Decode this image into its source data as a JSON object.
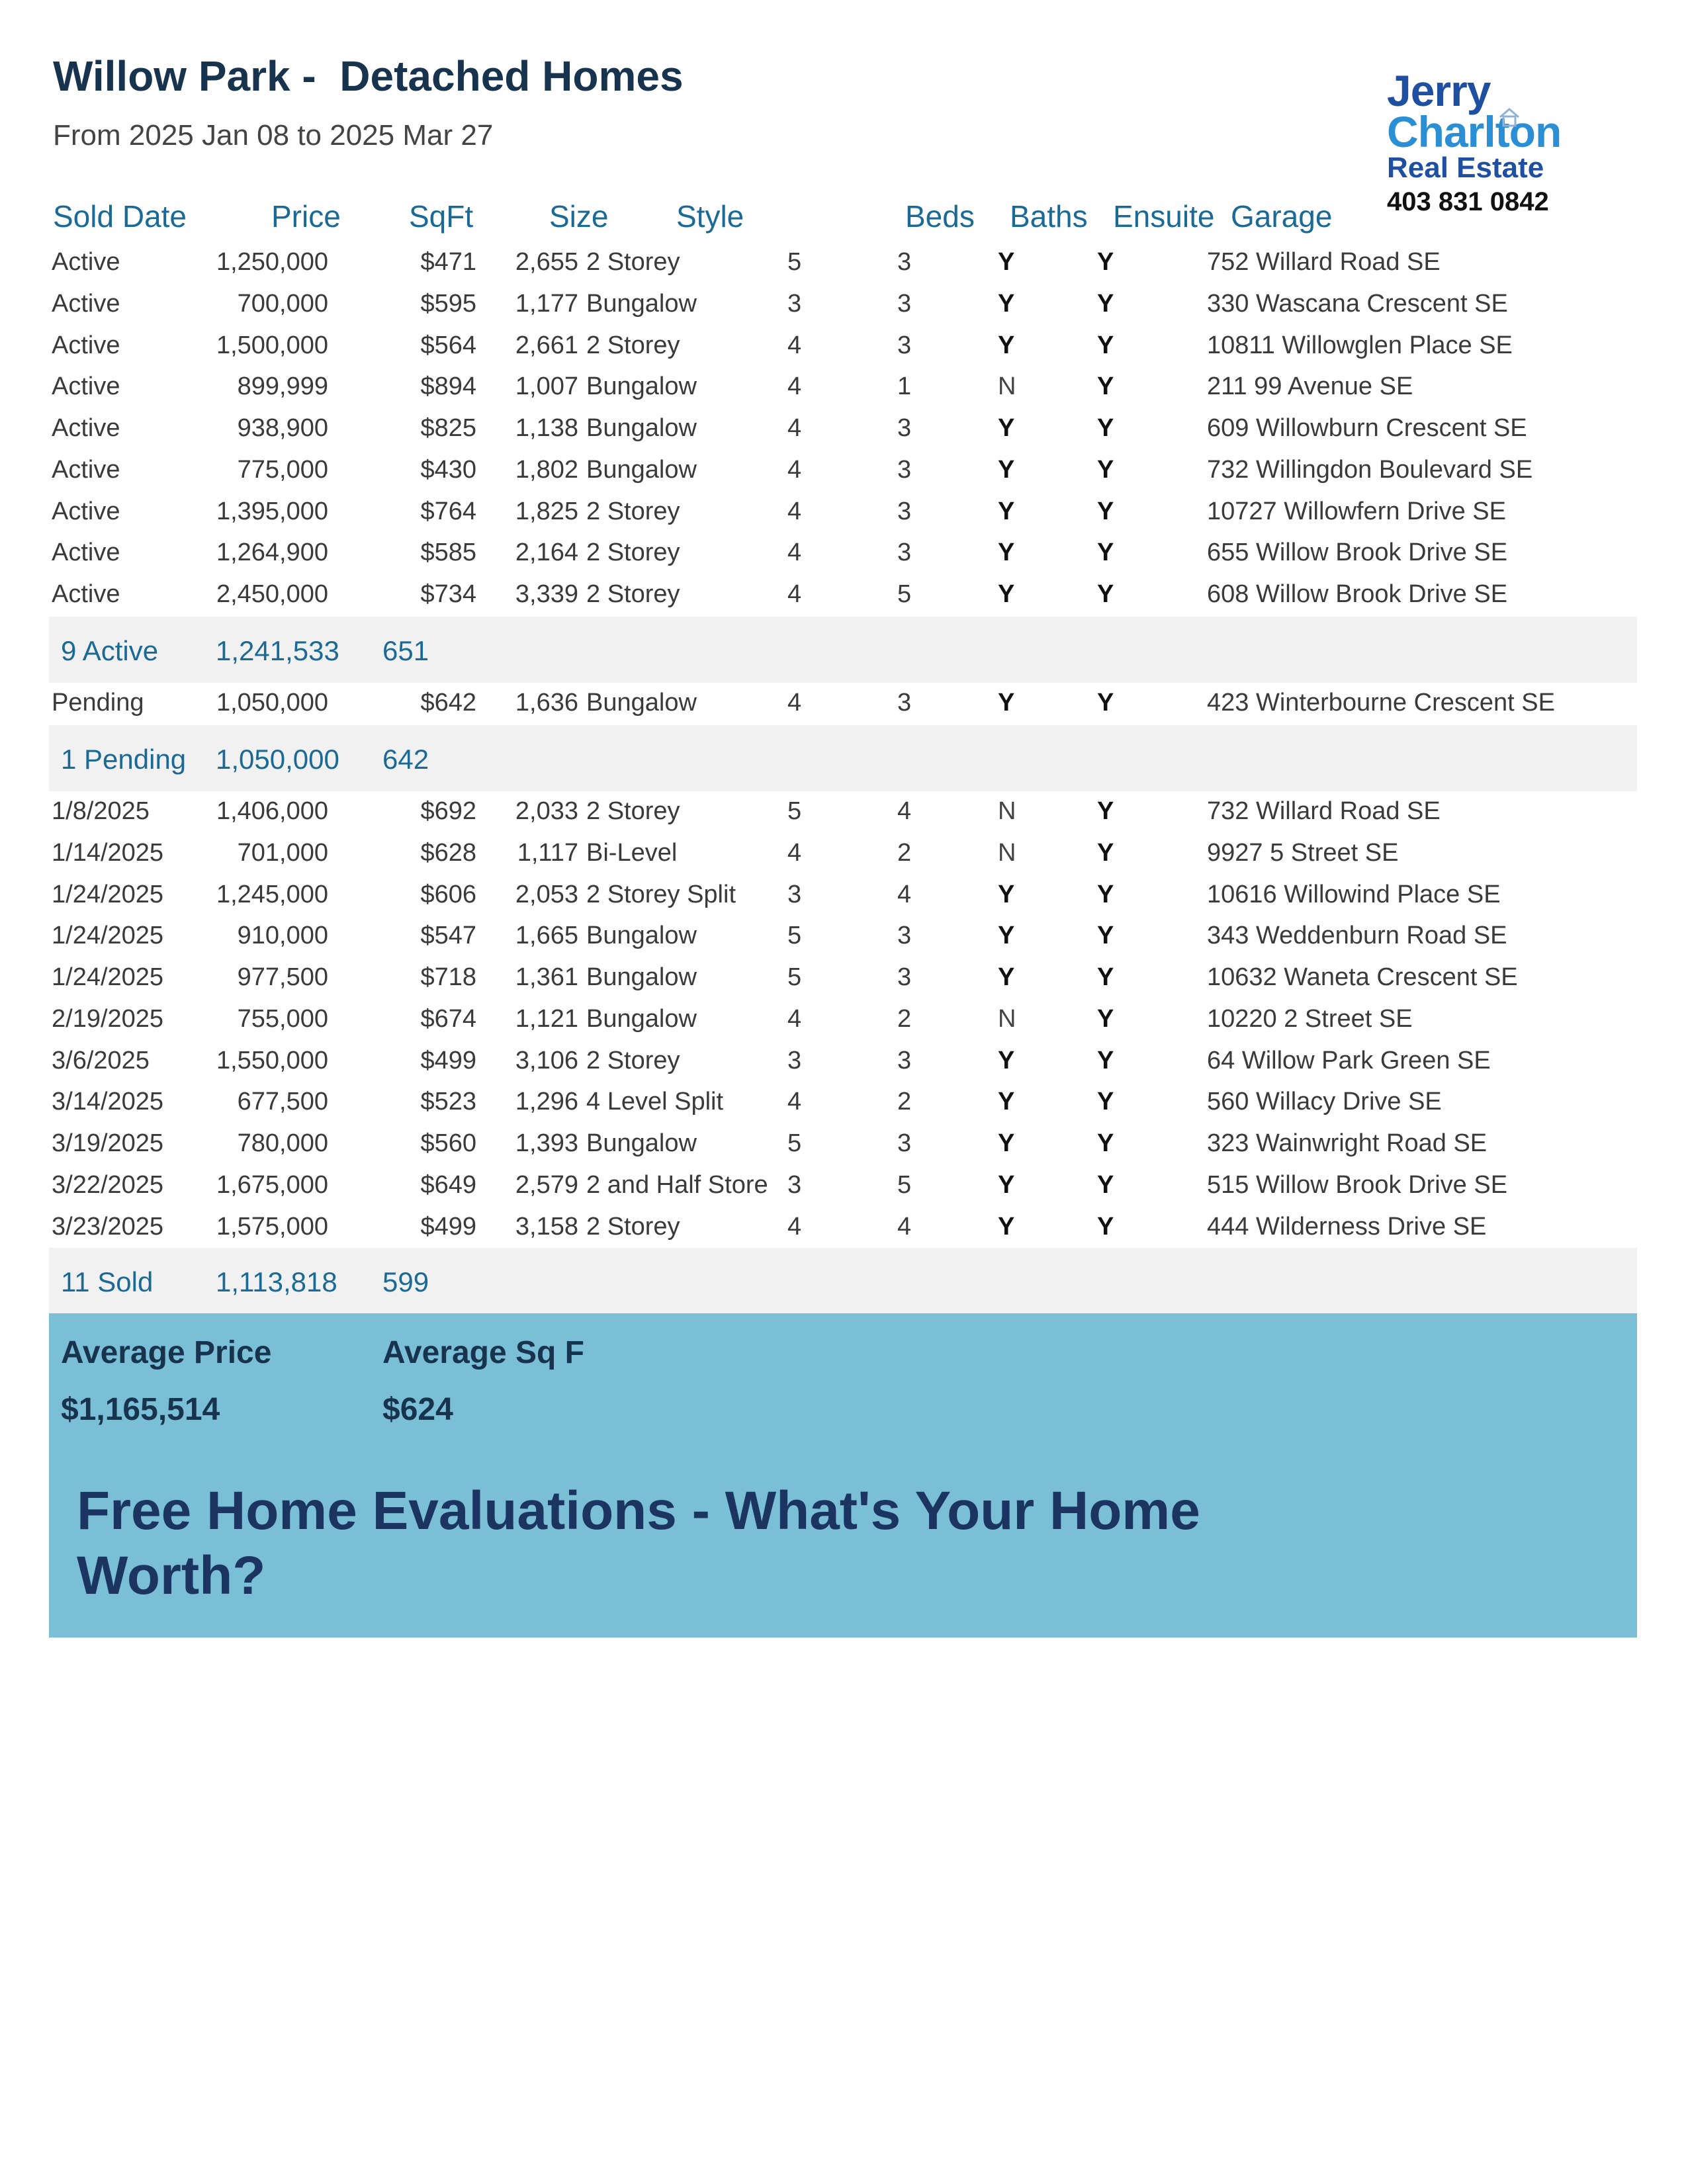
{
  "header": {
    "title": "Willow Park -  Detached Homes",
    "subtitle": "From 2025 Jan 08 to 2025 Mar 27"
  },
  "logo": {
    "line1": "Jerry",
    "line2": "Charlton",
    "line3": "Real Estate",
    "phone": "403 831 0842",
    "house_icon": "house-icon",
    "colors": {
      "dark_blue": "#1f4fa0",
      "light_blue": "#2b8fd6"
    }
  },
  "columns": [
    "Sold Date",
    "Price",
    "SqFt",
    "Size",
    "Style",
    "Beds",
    "Baths",
    "Ensuite",
    "Garage"
  ],
  "active": [
    [
      "Active",
      "1,250,000",
      "$471",
      "2,655",
      "2 Storey",
      "5",
      "3",
      "Y",
      "Y",
      "752 Willard Road SE"
    ],
    [
      "Active",
      "700,000",
      "$595",
      "1,177",
      "Bungalow",
      "3",
      "3",
      "Y",
      "Y",
      "330 Wascana Crescent SE"
    ],
    [
      "Active",
      "1,500,000",
      "$564",
      "2,661",
      "2 Storey",
      "4",
      "3",
      "Y",
      "Y",
      "10811 Willowglen Place SE"
    ],
    [
      "Active",
      "899,999",
      "$894",
      "1,007",
      "Bungalow",
      "4",
      "1",
      "N",
      "Y",
      "211 99 Avenue SE"
    ],
    [
      "Active",
      "938,900",
      "$825",
      "1,138",
      "Bungalow",
      "4",
      "3",
      "Y",
      "Y",
      "609 Willowburn Crescent SE"
    ],
    [
      "Active",
      "775,000",
      "$430",
      "1,802",
      "Bungalow",
      "4",
      "3",
      "Y",
      "Y",
      "732 Willingdon Boulevard SE"
    ],
    [
      "Active",
      "1,395,000",
      "$764",
      "1,825",
      "2 Storey",
      "4",
      "3",
      "Y",
      "Y",
      "10727 Willowfern Drive SE"
    ],
    [
      "Active",
      "1,264,900",
      "$585",
      "2,164",
      "2 Storey",
      "4",
      "3",
      "Y",
      "Y",
      "655 Willow Brook Drive SE"
    ],
    [
      "Active",
      "2,450,000",
      "$734",
      "3,339",
      "2 Storey",
      "4",
      "5",
      "Y",
      "Y",
      "608 Willow Brook Drive SE"
    ]
  ],
  "active_summary": {
    "label": "9 Active",
    "price": "1,241,533",
    "sqft": "651"
  },
  "pending": [
    [
      "Pending",
      "1,050,000",
      "$642",
      "1,636",
      "Bungalow",
      "4",
      "3",
      "Y",
      "Y",
      "423 Winterbourne Crescent SE"
    ]
  ],
  "pending_summary": {
    "label": "1 Pending",
    "price": "1,050,000",
    "sqft": "642"
  },
  "sold": [
    [
      "1/8/2025",
      "1,406,000",
      "$692",
      "2,033",
      "2 Storey",
      "5",
      "4",
      "N",
      "Y",
      "732 Willard Road SE"
    ],
    [
      "1/14/2025",
      "701,000",
      "$628",
      "1,117",
      "Bi-Level",
      "4",
      "2",
      "N",
      "Y",
      "9927 5 Street SE"
    ],
    [
      "1/24/2025",
      "1,245,000",
      "$606",
      "2,053",
      "2 Storey Split",
      "3",
      "4",
      "Y",
      "Y",
      "10616 Willowind Place SE"
    ],
    [
      "1/24/2025",
      "910,000",
      "$547",
      "1,665",
      "Bungalow",
      "5",
      "3",
      "Y",
      "Y",
      "343 Weddenburn Road SE"
    ],
    [
      "1/24/2025",
      "977,500",
      "$718",
      "1,361",
      "Bungalow",
      "5",
      "3",
      "Y",
      "Y",
      "10632 Waneta Crescent SE"
    ],
    [
      "2/19/2025",
      "755,000",
      "$674",
      "1,121",
      "Bungalow",
      "4",
      "2",
      "N",
      "Y",
      "10220 2 Street SE"
    ],
    [
      "3/6/2025",
      "1,550,000",
      "$499",
      "3,106",
      "2 Storey",
      "3",
      "3",
      "Y",
      "Y",
      "64 Willow Park Green SE"
    ],
    [
      "3/14/2025",
      "677,500",
      "$523",
      "1,296",
      "4 Level Split",
      "4",
      "2",
      "Y",
      "Y",
      "560 Willacy Drive SE"
    ],
    [
      "3/19/2025",
      "780,000",
      "$560",
      "1,393",
      "Bungalow",
      "5",
      "3",
      "Y",
      "Y",
      "323 Wainwright Road SE"
    ],
    [
      "3/22/2025",
      "1,675,000",
      "$649",
      "2,579",
      "2 and Half Store",
      "3",
      "5",
      "Y",
      "Y",
      "515 Willow Brook Drive SE"
    ],
    [
      "3/23/2025",
      "1,575,000",
      "$499",
      "3,158",
      "2 Storey",
      "4",
      "4",
      "Y",
      "Y",
      "444 Wilderness Drive SE"
    ]
  ],
  "sold_summary": {
    "label": "11 Sold",
    "price": "1,113,818",
    "sqft": "599"
  },
  "averages": {
    "price_label": "Average Price",
    "price_value": "$1,165,514",
    "sqft_label": "Average Sq F",
    "sqft_value": "$624"
  },
  "cta": "Free Home Evaluations - What's Your Home Worth?",
  "colors": {
    "title": "#17334d",
    "header_blue": "#1b6a96",
    "summary_bg": "#f1f1f1",
    "banner_bg": "#7bbfd6",
    "cta": "#1b3560"
  }
}
